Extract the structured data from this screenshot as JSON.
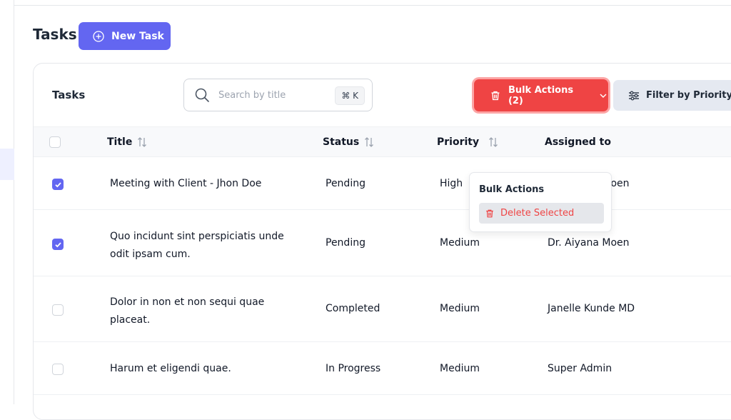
{
  "header": {
    "title": "Tasks",
    "new_task_label": "New Task"
  },
  "toolbar": {
    "card_title": "Tasks",
    "search_placeholder": "Search by title",
    "search_shortcut": "⌘ K",
    "bulk_actions_label": "Bulk Actions (2)",
    "filter_label": "Filter by Priority"
  },
  "table": {
    "columns": [
      "Title",
      "Status",
      "Priority",
      "Assigned to"
    ],
    "rows": [
      {
        "checked": true,
        "title_line1": "Meeting with Client - Jhon Doe",
        "title_line2": "",
        "status": "Pending",
        "priority": "High",
        "assigned": "Dr. Aiyana Moen"
      },
      {
        "checked": true,
        "title_line1": "Quo incidunt sint perspiciatis unde",
        "title_line2": "odit ipsam cum.",
        "status": "Pending",
        "priority": "Medium",
        "assigned": "Dr. Aiyana Moen"
      },
      {
        "checked": false,
        "title_line1": "Dolor in non et non sequi quae",
        "title_line2": "placeat.",
        "status": "Completed",
        "priority": "Medium",
        "assigned": "Janelle Kunde MD"
      },
      {
        "checked": false,
        "title_line1": "Harum et eligendi quae.",
        "title_line2": "",
        "status": "In Progress",
        "priority": "Medium",
        "assigned": "Super Admin"
      }
    ]
  },
  "bulk_menu": {
    "title": "Bulk Actions",
    "delete_label": "Delete Selected"
  },
  "colors": {
    "primary": "#6366f1",
    "danger": "#ef4444"
  }
}
